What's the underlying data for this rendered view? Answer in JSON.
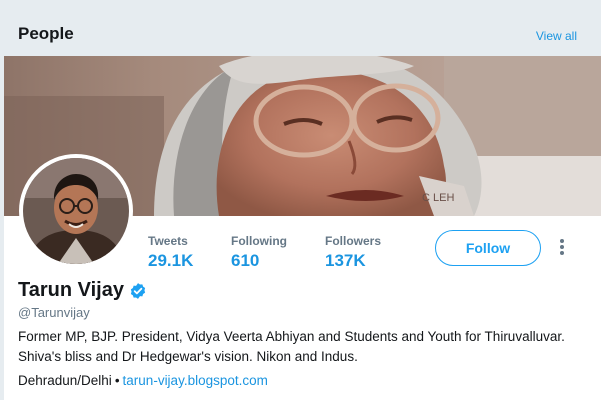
{
  "section": {
    "title": "People",
    "view_all_label": "View all"
  },
  "profile": {
    "banner_image": "elderly-woman-with-glasses-photo",
    "avatar_image": "man-with-glasses-portrait",
    "display_name": "Tarun Vijay",
    "verified": true,
    "handle": "@Tarunvijay",
    "bio": "Former MP, BJP. President, Vidya Veerta Abhiyan and Students and Youth for Thiruvalluvar. Shiva's bliss and Dr Hedgewar's vision. Nikon and Indus.",
    "location": "Dehradun/Delhi",
    "separator": "•",
    "url_text": "tarun-vijay.blogspot.com",
    "follow_label": "Follow",
    "stats": {
      "tweets_label": "Tweets",
      "tweets_value": "29.1K",
      "following_label": "Following",
      "following_value": "610",
      "followers_label": "Followers",
      "followers_value": "137K"
    }
  },
  "colors": {
    "accent": "#1da1f2",
    "link": "#1b95e0",
    "page_background": "#e6ecf0",
    "text_primary": "#14171a",
    "text_secondary": "#657786"
  }
}
